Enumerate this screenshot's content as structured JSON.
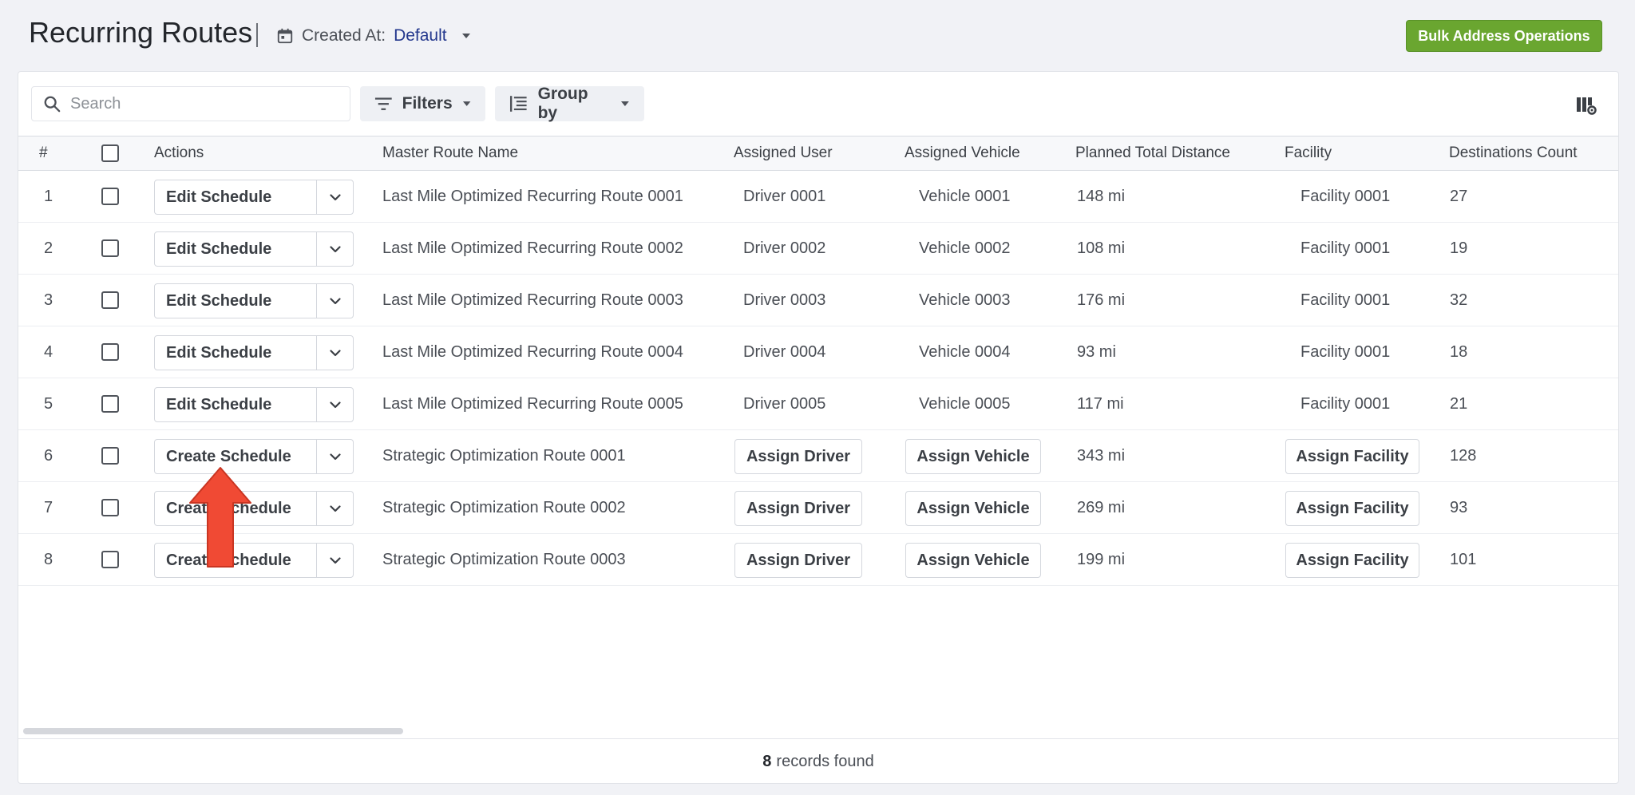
{
  "header": {
    "title": "Recurring Routes",
    "created_at_label": "Created At:",
    "created_at_value": "Default",
    "bulk_button": "Bulk Address Operations"
  },
  "toolbar": {
    "search_placeholder": "Search",
    "filters_label": "Filters",
    "group_by_label": "Group by"
  },
  "columns": {
    "index": "#",
    "actions": "Actions",
    "name": "Master Route Name",
    "user": "Assigned User",
    "vehicle": "Assigned Vehicle",
    "distance": "Planned Total Distance",
    "facility": "Facility",
    "destinations": "Destinations Count"
  },
  "rows": [
    {
      "num": "1",
      "action": "Edit Schedule",
      "name": "Last Mile Optimized Recurring Route 0001",
      "user": "Driver 0001",
      "vehicle": "Vehicle 0001",
      "distance": "148 mi",
      "facility": "Facility 0001",
      "dest": "27"
    },
    {
      "num": "2",
      "action": "Edit Schedule",
      "name": "Last Mile Optimized Recurring Route 0002",
      "user": "Driver 0002",
      "vehicle": "Vehicle 0002",
      "distance": "108 mi",
      "facility": "Facility 0001",
      "dest": "19"
    },
    {
      "num": "3",
      "action": "Edit Schedule",
      "name": "Last Mile Optimized Recurring Route 0003",
      "user": "Driver 0003",
      "vehicle": "Vehicle 0003",
      "distance": "176 mi",
      "facility": "Facility 0001",
      "dest": "32"
    },
    {
      "num": "4",
      "action": "Edit Schedule",
      "name": "Last Mile Optimized Recurring Route 0004",
      "user": "Driver 0004",
      "vehicle": "Vehicle 0004",
      "distance": "93 mi",
      "facility": "Facility 0001",
      "dest": "18"
    },
    {
      "num": "5",
      "action": "Edit Schedule",
      "name": "Last Mile Optimized Recurring Route 0005",
      "user": "Driver 0005",
      "vehicle": "Vehicle 0005",
      "distance": "117 mi",
      "facility": "Facility 0001",
      "dest": "21"
    },
    {
      "num": "6",
      "action": "Create Schedule",
      "name": "Strategic Optimization Route 0001",
      "user": "Assign Driver",
      "vehicle": "Assign Vehicle",
      "distance": "343 mi",
      "facility": "Assign Facility",
      "dest": "128"
    },
    {
      "num": "7",
      "action": "Create Schedule",
      "name": "Strategic Optimization Route 0002",
      "user": "Assign Driver",
      "vehicle": "Assign Vehicle",
      "distance": "269 mi",
      "facility": "Assign Facility",
      "dest": "93"
    },
    {
      "num": "8",
      "action": "Create Schedule",
      "name": "Strategic Optimization Route 0003",
      "user": "Assign Driver",
      "vehicle": "Assign Vehicle",
      "distance": "199 mi",
      "facility": "Assign Facility",
      "dest": "101"
    }
  ],
  "footer": {
    "count": "8",
    "label": "records found"
  },
  "colors": {
    "accent_green": "#6aa630",
    "link_blue": "#24388d",
    "annotation_arrow": "#f04a34"
  }
}
